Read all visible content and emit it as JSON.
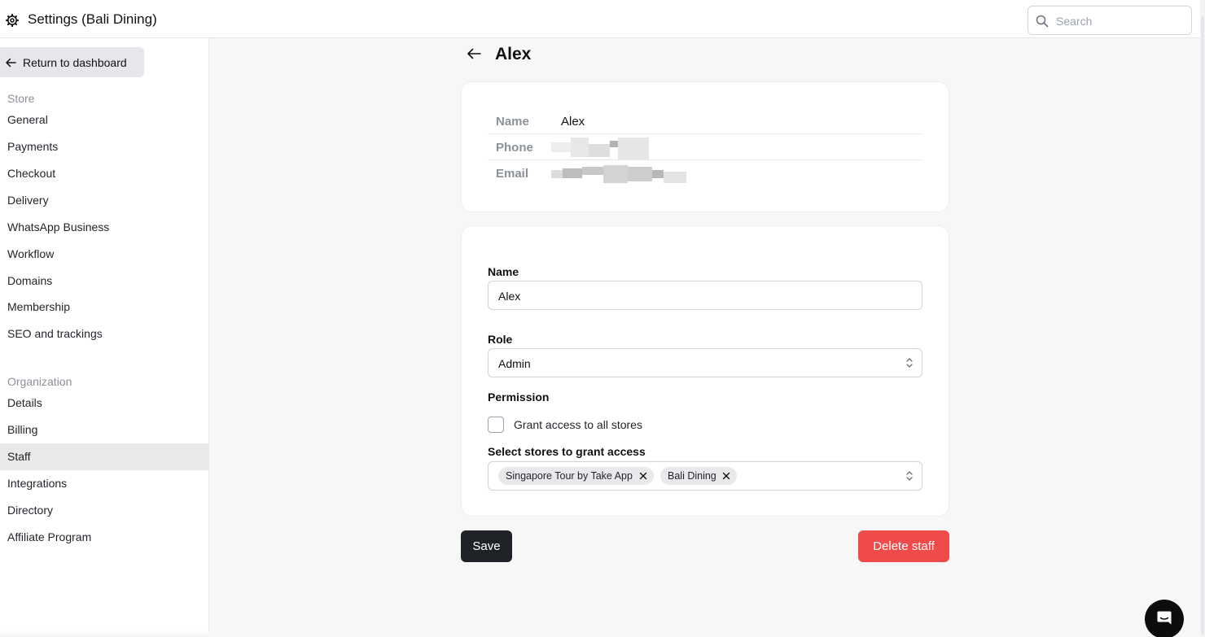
{
  "app": {
    "title": "Settings (Bali Dining)"
  },
  "search": {
    "placeholder": "Search"
  },
  "sidebar": {
    "back_label": "Return to dashboard",
    "store_section": "Store",
    "store_items": [
      {
        "label": "General"
      },
      {
        "label": "Payments"
      },
      {
        "label": "Checkout"
      },
      {
        "label": "Delivery"
      },
      {
        "label": "WhatsApp Business"
      },
      {
        "label": "Workflow"
      },
      {
        "label": "Domains"
      },
      {
        "label": "Membership"
      },
      {
        "label": "SEO and trackings"
      }
    ],
    "org_section": "Organization",
    "org_items": [
      {
        "label": "Details"
      },
      {
        "label": "Billing"
      },
      {
        "label": "Staff"
      },
      {
        "label": "Integrations"
      },
      {
        "label": "Directory"
      },
      {
        "label": "Affiliate Program"
      }
    ],
    "active": "Staff"
  },
  "page": {
    "title": "Alex"
  },
  "info": {
    "name_label": "Name",
    "name_value": "Alex",
    "phone_label": "Phone",
    "email_label": "Email",
    "redacted": true
  },
  "form": {
    "name_label": "Name",
    "name_value": "Alex",
    "role_label": "Role",
    "role_value": "Admin",
    "permission_label": "Permission",
    "grant_all_label": "Grant access to all stores",
    "grant_all_checked": false,
    "stores_label": "Select stores to grant access",
    "selected_stores": [
      "Singapore Tour by Take App",
      "Bali Dining"
    ]
  },
  "actions": {
    "save_label": "Save",
    "delete_label": "Delete staff"
  },
  "colors": {
    "primary": "#1f2328",
    "danger": "#ef4b4b",
    "active_nav": "#e9e9ea",
    "muted": "#8b9099"
  },
  "icons": [
    "gear-icon",
    "search-icon",
    "arrow-left-icon",
    "chevron-updown-icon",
    "close-icon",
    "chat-icon"
  ]
}
